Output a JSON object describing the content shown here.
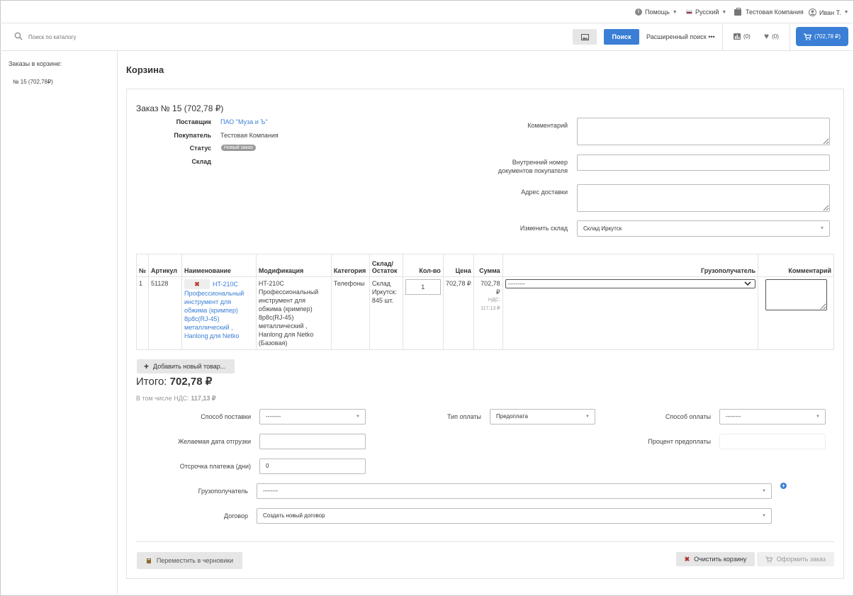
{
  "topbar": {
    "help": "Помощь",
    "language": "Русский",
    "company": "Тестовая Компания",
    "user": "Иван Т."
  },
  "search": {
    "placeholder": "Поиск по каталогу",
    "button": "Поиск",
    "advanced": "Расширенный поиск •••"
  },
  "counters": {
    "compare": "(0)",
    "favorites": "(0)",
    "cart": "(702,78 ₽)"
  },
  "sidebar": {
    "title": "Заказы в корзине:",
    "orders": [
      "№ 15 (702,78₽)"
    ]
  },
  "page": {
    "title": "Корзина"
  },
  "order": {
    "heading": "Заказ № 15 (702,78 ₽)",
    "supplier_label": "Поставщик",
    "supplier": "ПАО \"Муза и Ъ\"",
    "buyer_label": "Покупатель",
    "buyer": "Тестовая Компания",
    "status_label": "Статус",
    "status": "Новый заказ",
    "warehouse_label": "Склад",
    "comment_label": "Комментарий",
    "internal_number_label_1": "Внутренний номер",
    "internal_number_label_2": "документов покупателя",
    "address_label": "Адрес доставки",
    "change_warehouse_label": "Изменить склад",
    "change_warehouse_value": "Склад Иркутск"
  },
  "table": {
    "headers": {
      "num": "№",
      "sku": "Артикул",
      "name": "Наименование",
      "modification": "Модификация",
      "category": "Категория",
      "stock_1": "Склад/",
      "stock_2": "Остаток",
      "qty": "Кол-во",
      "price": "Цена",
      "sum": "Сумма",
      "consignee": "Грузополучатель",
      "comment": "Комментарий"
    },
    "rows": [
      {
        "num": "1",
        "sku": "51128",
        "name": "HT-210C Профессиональный инструмент для обжима (кримпер) 8p8c(RJ-45) металлический , Hanlong для Netko",
        "modification": "HT-210C Профессиональный инструмент для обжима (кримпер) 8p8c(RJ-45) металлический , Hanlong для Netko (Базовая)",
        "category": "Телефоны",
        "stock": "Склад Иркутск: 845 шт.",
        "qty": "1",
        "price": "702,78 ₽",
        "sum": "702,78 ₽",
        "vat_label": "НДС:",
        "vat": "117,13 ₽",
        "consignee": "---------"
      }
    ]
  },
  "actions": {
    "add_product": "Добавить новый товар...",
    "total_label": "Итого:",
    "total_value": "702,78 ₽",
    "vat_prefix": "В том числе НДС:",
    "vat_value": "117,13 ₽",
    "move_to_drafts": "Переместить в черновики",
    "clear_cart": "Очистить корзину",
    "checkout": "Оформить заказ"
  },
  "form": {
    "delivery_method_label": "Способ поставки",
    "delivery_method": "--------",
    "payment_type_label": "Тип оплаты",
    "payment_type": "Предоплата",
    "payment_method_label": "Способ оплаты",
    "payment_method": "--------",
    "ship_date_label": "Желаемая дата отгрузки",
    "prepay_percent_label": "Процент предоплаты",
    "deferral_label": "Отсрочка платежа (дни)",
    "deferral": "0",
    "consignee_label": "Грузополучатель",
    "consignee": "--------",
    "contract_label": "Договор",
    "contract": "Создать новый договор"
  }
}
